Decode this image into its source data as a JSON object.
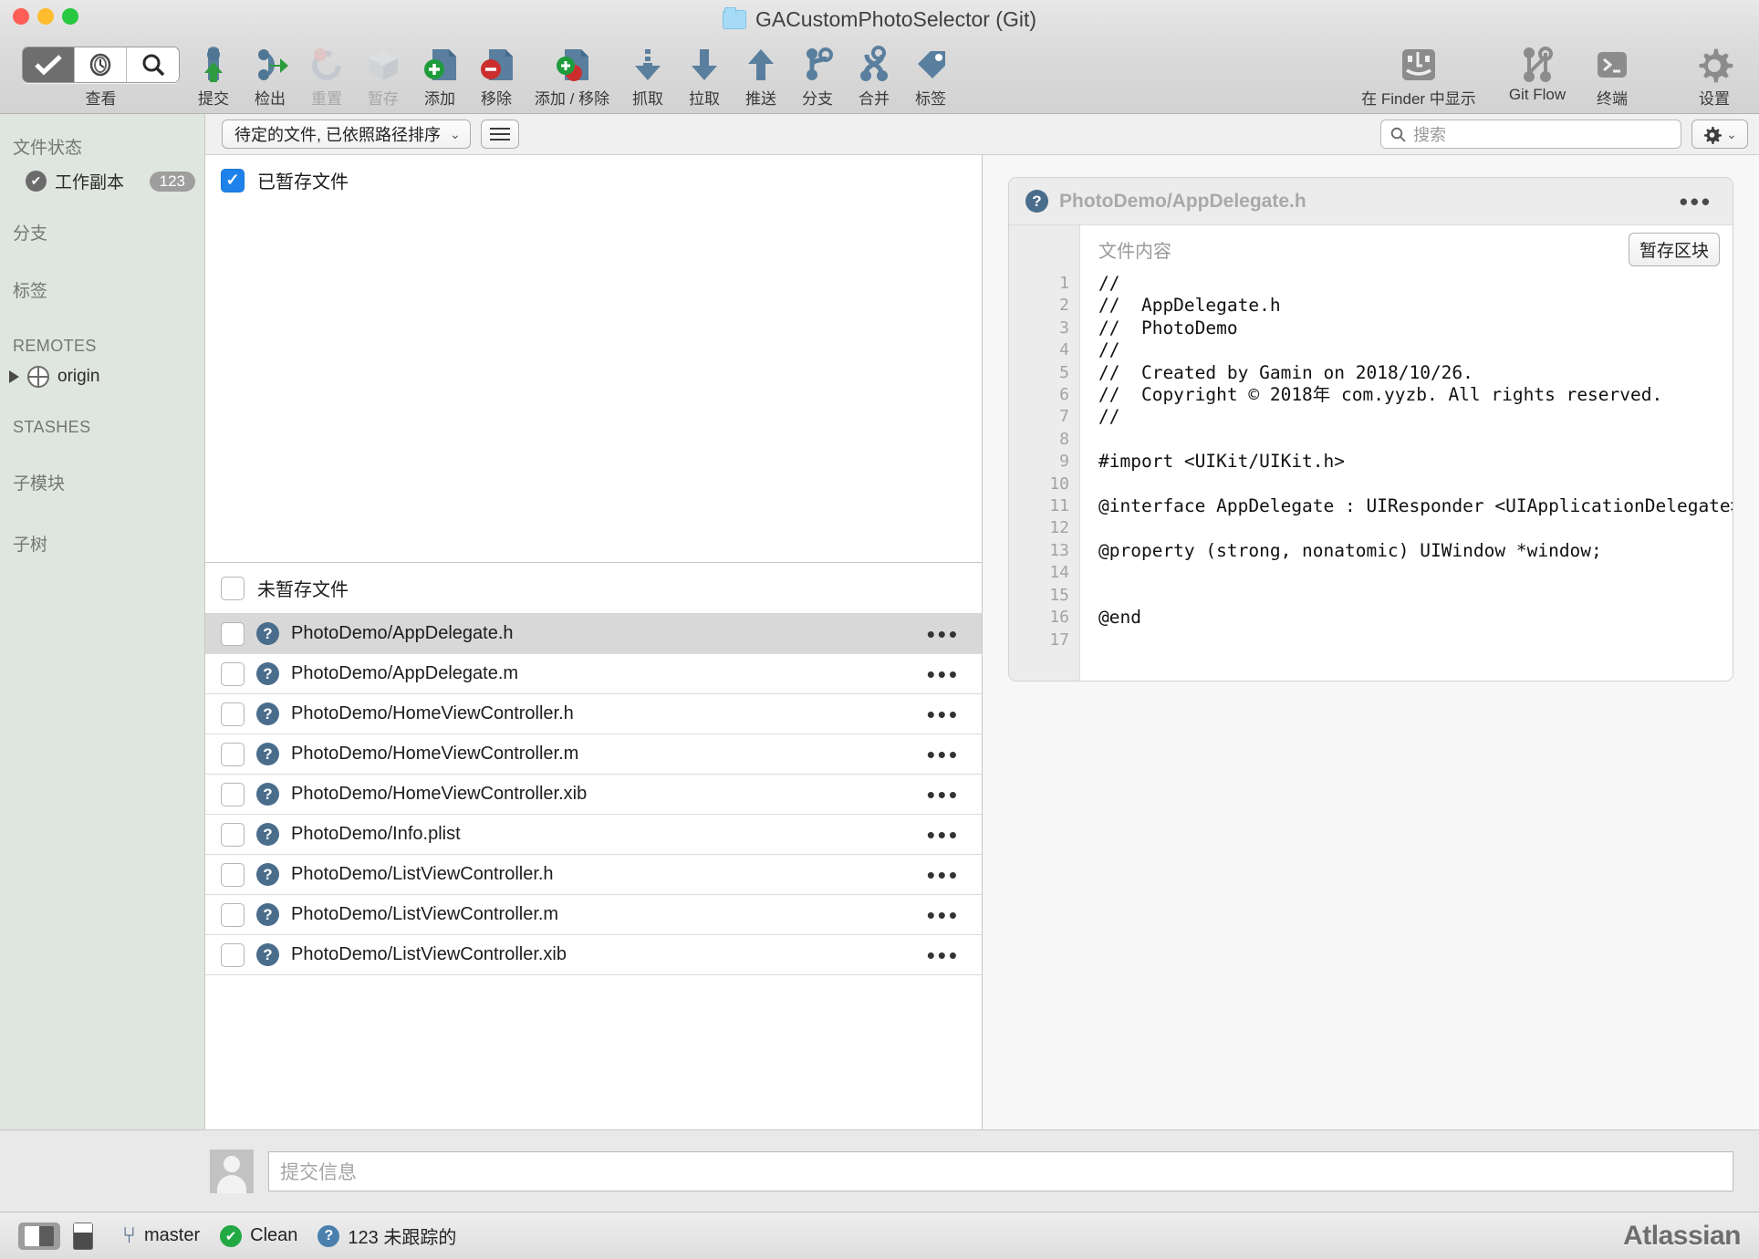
{
  "window": {
    "title": "GACustomPhotoSelector (Git)",
    "folder_icon": "folder-icon"
  },
  "toolbar": {
    "view_label": "查看",
    "items": [
      {
        "label": "提交",
        "icon": "commit-icon",
        "disabled": false
      },
      {
        "label": "检出",
        "icon": "checkout-icon",
        "disabled": false
      },
      {
        "label": "重置",
        "icon": "reset-icon",
        "disabled": true
      },
      {
        "label": "暂存",
        "icon": "stash-icon",
        "disabled": true
      },
      {
        "label": "添加",
        "icon": "add-icon",
        "disabled": false
      },
      {
        "label": "移除",
        "icon": "remove-icon",
        "disabled": false
      },
      {
        "label": "添加 / 移除",
        "icon": "add-remove-icon",
        "disabled": false
      },
      {
        "label": "抓取",
        "icon": "fetch-icon",
        "disabled": false
      },
      {
        "label": "拉取",
        "icon": "pull-icon",
        "disabled": false
      },
      {
        "label": "推送",
        "icon": "push-icon",
        "disabled": false
      },
      {
        "label": "分支",
        "icon": "branch-icon",
        "disabled": false
      },
      {
        "label": "合并",
        "icon": "merge-icon",
        "disabled": false
      },
      {
        "label": "标签",
        "icon": "tag-icon",
        "disabled": false
      }
    ],
    "right_items": [
      {
        "label": "在 Finder 中显示",
        "icon": "finder-icon"
      },
      {
        "label": "Git Flow",
        "icon": "gitflow-icon"
      },
      {
        "label": "终端",
        "icon": "terminal-icon"
      }
    ],
    "settings_label": "设置",
    "settings_icon": "gear-icon"
  },
  "sidebar": {
    "file_status_header": "文件状态",
    "working_copy_label": "工作副本",
    "working_copy_count": "123",
    "branches_header": "分支",
    "tags_header": "标签",
    "remotes_header": "REMOTES",
    "remote_origin": "origin",
    "stashes_header": "STASHES",
    "submodules_header": "子模块",
    "subtrees_header": "子树"
  },
  "filterbar": {
    "sort_label": "待定的文件, 已依照路径排序",
    "list_view_icon": "list-view-icon",
    "search_placeholder": "搜索",
    "search_icon": "search-icon",
    "settings_icon": "gear-icon",
    "chevron_icon": "chevron-down-icon"
  },
  "filelist": {
    "staged_header": "已暂存文件",
    "staged_checked": true,
    "staged_files": [],
    "unstaged_header": "未暂存文件",
    "unstaged_checked": false,
    "unstaged_files": [
      {
        "name": "PhotoDemo/AppDelegate.h",
        "status": "untracked",
        "selected": true
      },
      {
        "name": "PhotoDemo/AppDelegate.m",
        "status": "untracked",
        "selected": false
      },
      {
        "name": "PhotoDemo/HomeViewController.h",
        "status": "untracked",
        "selected": false
      },
      {
        "name": "PhotoDemo/HomeViewController.m",
        "status": "untracked",
        "selected": false
      },
      {
        "name": "PhotoDemo/HomeViewController.xib",
        "status": "untracked",
        "selected": false
      },
      {
        "name": "PhotoDemo/Info.plist",
        "status": "untracked",
        "selected": false
      },
      {
        "name": "PhotoDemo/ListViewController.h",
        "status": "untracked",
        "selected": false
      },
      {
        "name": "PhotoDemo/ListViewController.m",
        "status": "untracked",
        "selected": false
      },
      {
        "name": "PhotoDemo/ListViewController.xib",
        "status": "untracked",
        "selected": false
      }
    ],
    "row_menu_icon": "ellipsis-icon"
  },
  "diff": {
    "file_title": "PhotoDemo/AppDelegate.h",
    "file_icon": "question-status-icon",
    "menu_icon": "ellipsis-icon",
    "content_label": "文件内容",
    "stage_hunk_label": "暂存区块",
    "line_numbers": [
      "1",
      "2",
      "3",
      "4",
      "5",
      "6",
      "7",
      "8",
      "9",
      "10",
      "11",
      "12",
      "13",
      "14",
      "15",
      "16",
      "17"
    ],
    "lines": [
      "//",
      "//  AppDelegate.h",
      "//  PhotoDemo",
      "//",
      "//  Created by Gamin on 2018/10/26.",
      "//  Copyright © 2018年 com.yyzb. All rights reserved.",
      "//",
      "",
      "#import <UIKit/UIKit.h>",
      "",
      "@interface AppDelegate : UIResponder <UIApplicationDelegate>",
      "",
      "@property (strong, nonatomic) UIWindow *window;",
      "",
      "",
      "@end",
      ""
    ]
  },
  "commit": {
    "avatar_icon": "avatar-icon",
    "placeholder": "提交信息",
    "value": ""
  },
  "status": {
    "sidebar_toggle_icon": "sidebar-toggle-icon",
    "panel_toggle_icon": "panel-toggle-icon",
    "branch_icon": "branch-icon",
    "branch_name": "master",
    "clean_icon": "check-circle-icon",
    "clean_label": "Clean",
    "untracked_icon": "question-circle-icon",
    "untracked_label": "123 未跟踪的",
    "brand": "Atlassian"
  },
  "colors": {
    "accent_blue": "#1e82ea",
    "untracked_blue": "#4a6d8c",
    "clean_green": "#22a944",
    "sidebar_bg": "#dfe5df"
  }
}
